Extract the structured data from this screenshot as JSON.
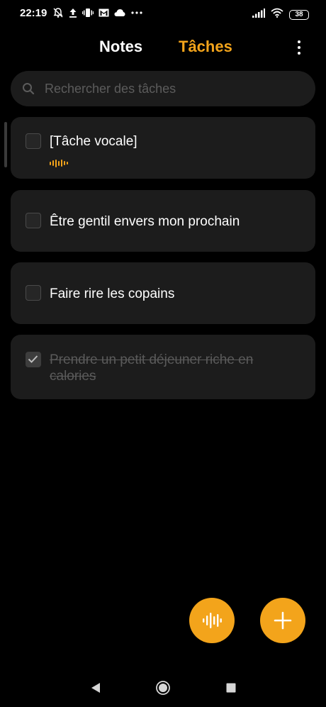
{
  "status_bar": {
    "time": "22:19",
    "battery": "38",
    "left_icons": [
      "notifications-off-icon",
      "upload-icon",
      "vibrate-icon",
      "gmail-icon",
      "cloud-icon",
      "more-dots-icon"
    ],
    "right_icons": [
      "signal-icon",
      "wifi-icon",
      "battery-icon"
    ]
  },
  "header": {
    "tab_notes": "Notes",
    "tab_tasks": "Tâches",
    "active_tab": "Tâches",
    "menu_icon": "more-vertical-icon"
  },
  "search": {
    "placeholder": "Rechercher des tâches",
    "icon": "search-icon"
  },
  "tasks": [
    {
      "text": "[Tâche vocale]",
      "done": false,
      "voice": true
    },
    {
      "text": "Être gentil envers mon prochain",
      "done": false,
      "voice": false
    },
    {
      "text": "Faire rire les copains",
      "done": false,
      "voice": false
    },
    {
      "text": "Prendre un petit déjeuner riche en calories",
      "line1": "Prendre un petit déjeuner riche en",
      "line2": "calories",
      "done": true,
      "voice": false
    }
  ],
  "fabs": {
    "voice_icon": "voice-record-icon",
    "add_icon": "plus-icon"
  },
  "nav": {
    "icons": [
      "back-icon",
      "home-icon",
      "recents-icon"
    ]
  },
  "colors": {
    "accent": "#f3a41b",
    "background": "#000000",
    "card": "#1c1c1c",
    "done_text": "#5a5a5a"
  }
}
